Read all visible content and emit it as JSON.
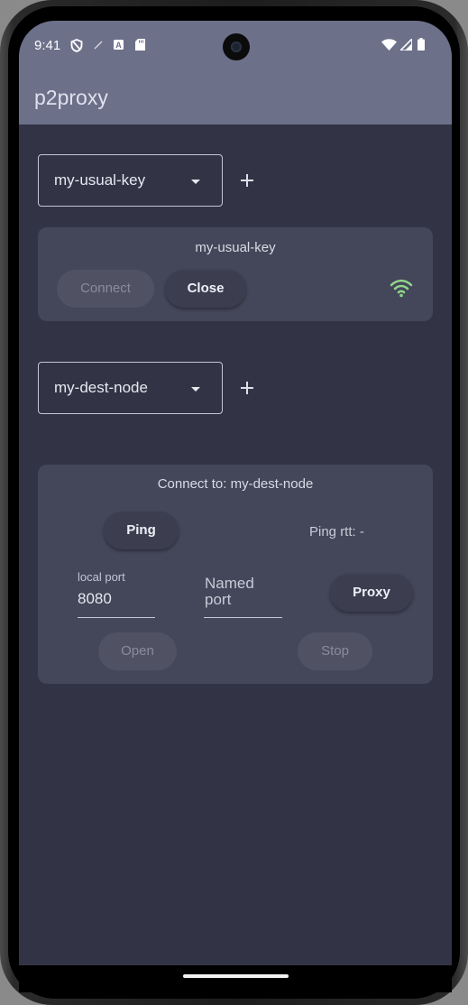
{
  "status_bar": {
    "time": "9:41",
    "icons": [
      "shield-icon",
      "no-signal-icon",
      "a-icon",
      "sd-card-icon",
      "wifi-status-icon",
      "cell-signal-icon",
      "battery-icon"
    ]
  },
  "app": {
    "title": "p2proxy",
    "colors": {
      "appbar": "#6c7089",
      "background": "#323446",
      "card": "#444659",
      "wifi_connected": "#8fd48a"
    }
  },
  "key_selector": {
    "value": "my-usual-key",
    "add_icon": "plus-icon"
  },
  "key_card": {
    "title": "my-usual-key",
    "connect_label": "Connect",
    "close_label": "Close",
    "status_icon": "wifi-connected-icon"
  },
  "dest_selector": {
    "value": "my-dest-node",
    "add_icon": "plus-icon"
  },
  "dest_card": {
    "title": "Connect to: my-dest-node",
    "ping_label": "Ping",
    "ping_rtt": "Ping rtt: -",
    "local_port_label": "local port",
    "local_port_value": "8080",
    "named_port_placeholder": "Named port",
    "proxy_label": "Proxy",
    "open_label": "Open",
    "stop_label": "Stop"
  }
}
